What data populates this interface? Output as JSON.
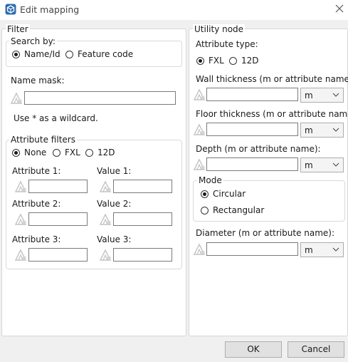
{
  "window": {
    "title": "Edit mapping",
    "icon": "app-cube-icon",
    "close_icon": "close-icon"
  },
  "filter": {
    "legend": "Filter",
    "search_by": {
      "legend": "Search by:",
      "options": [
        "Name/Id",
        "Feature code"
      ],
      "selected": "Name/Id"
    },
    "name_mask": {
      "label": "Name mask:",
      "value": ""
    },
    "wildcard_hint": "Use * as a wildcard.",
    "attribute_filters": {
      "legend": "Attribute filters",
      "options": [
        "None",
        "FXL",
        "12D"
      ],
      "selected": "None",
      "rows": [
        {
          "attr_label": "Attribute 1:",
          "value_label": "Value 1:",
          "attr_value": "",
          "value_value": ""
        },
        {
          "attr_label": "Attribute 2:",
          "value_label": "Value 2:",
          "attr_value": "",
          "value_value": ""
        },
        {
          "attr_label": "Attribute 3:",
          "value_label": "Value 3:",
          "attr_value": "",
          "value_value": ""
        }
      ]
    }
  },
  "utility_node": {
    "legend": "Utility node",
    "attribute_type": {
      "label": "Attribute type:",
      "options": [
        "FXL",
        "12D"
      ],
      "selected": "FXL"
    },
    "wall_thickness": {
      "label": "Wall thickness (m or attribute name):",
      "value": "",
      "unit": "m"
    },
    "floor_thickness": {
      "label": "Floor thickness (m or attribute name):",
      "value": "",
      "unit": "m"
    },
    "depth": {
      "label": "Depth (m or attribute name):",
      "value": "",
      "unit": "m"
    },
    "mode": {
      "legend": "Mode",
      "options": [
        "Circular",
        "Rectangular"
      ],
      "selected": "Circular"
    },
    "diameter": {
      "label": "Diameter (m or attribute name):",
      "value": "",
      "unit": "m"
    }
  },
  "buttons": {
    "ok": "OK",
    "cancel": "Cancel"
  },
  "icons": {
    "attribute": "attribute-picker-icon",
    "dropdown": "chevron-down-icon"
  }
}
